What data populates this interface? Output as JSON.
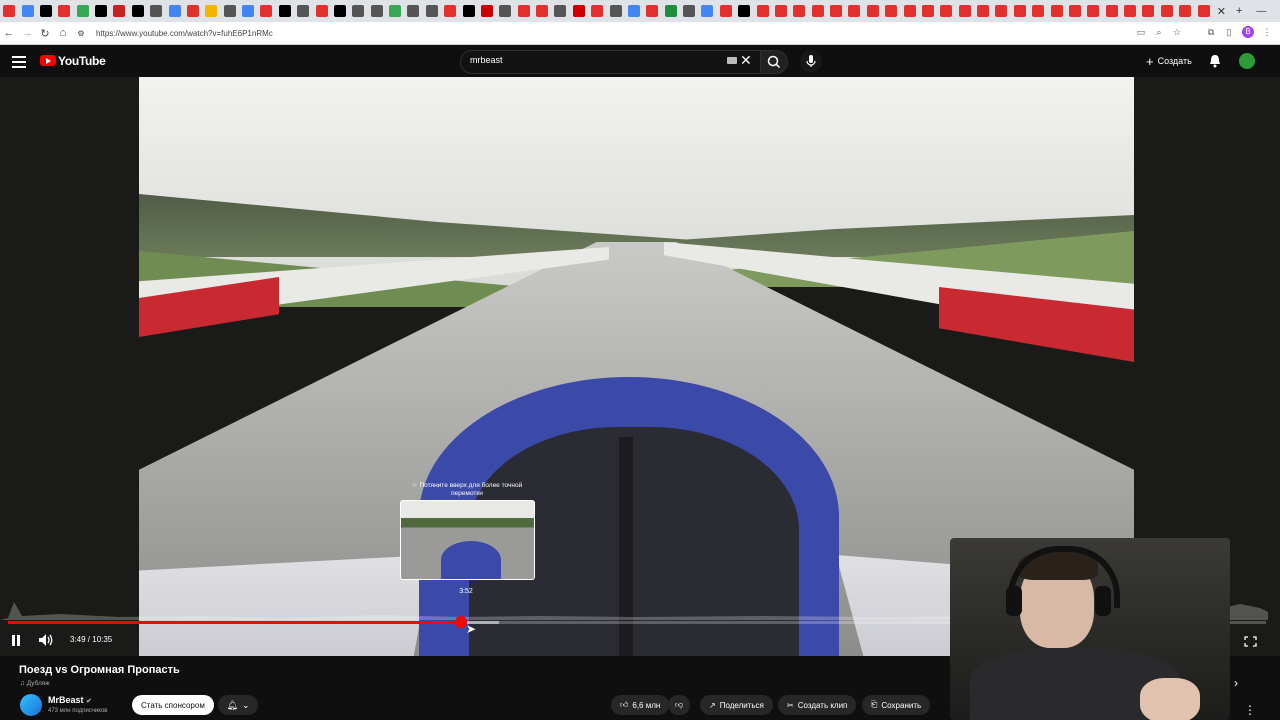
{
  "browser": {
    "url": "https://www.youtube.com/watch?v=fuhE6P1nRMc",
    "profile_initial": "B",
    "tab_favicon_colors": [
      "#e2312d",
      "#4285f4",
      "#000000",
      "#e2312d",
      "#34a853",
      "#000000",
      "#c5221f",
      "#000000",
      "#555555",
      "#4285f4",
      "#e2312d",
      "#f4b400",
      "#555555",
      "#4285f4",
      "#e2312d",
      "#000000",
      "#555555",
      "#e2312d",
      "#000000",
      "#555555",
      "#555555",
      "#34a853",
      "#555555",
      "#555555",
      "#e2312d",
      "#000000",
      "#cc0000",
      "#555555",
      "#e2312d",
      "#e2312d",
      "#555555",
      "#cc0000",
      "#e2312d",
      "#555555",
      "#4285f4",
      "#e2312d",
      "#1e8e3e",
      "#555555",
      "#4285f4",
      "#e2312d",
      "#000000",
      "#e2312d",
      "#e2312d",
      "#e2312d",
      "#e2312d",
      "#e2312d",
      "#e2312d",
      "#e2312d",
      "#e2312d",
      "#e2312d",
      "#e2312d",
      "#e2312d",
      "#e2312d",
      "#e2312d",
      "#e2312d",
      "#e2312d",
      "#e2312d",
      "#e2312d",
      "#e2312d",
      "#e2312d",
      "#e2312d",
      "#e2312d",
      "#e2312d",
      "#e2312d",
      "#e2312d",
      "#e2312d"
    ]
  },
  "header": {
    "logo_text": "YouTube",
    "search_value": "mrbeast",
    "create_label": "Создать"
  },
  "player": {
    "hover_hint": "Потяните вверх для более точной перемотки",
    "hover_time": "3:52",
    "current_time": "3:49",
    "duration": "10:35",
    "time_display": "3:49 / 10:35",
    "progress_fraction": 0.36,
    "buffered_fraction": 0.39
  },
  "video_info": {
    "title": "Поезд vs Огромная Пропасть",
    "dubbed_label": "Дубляж",
    "channel_name": "MrBeast",
    "subscribers": "473 млн подписчиков",
    "sponsor_label": "Стать спонсором",
    "likes": "6,6 млн",
    "share_label": "Поделиться",
    "clip_label": "Создать клип",
    "save_label": "Сохранить"
  },
  "colors": {
    "accent": "#ff0000",
    "background": "#0f0f0f",
    "pill": "#272727"
  }
}
